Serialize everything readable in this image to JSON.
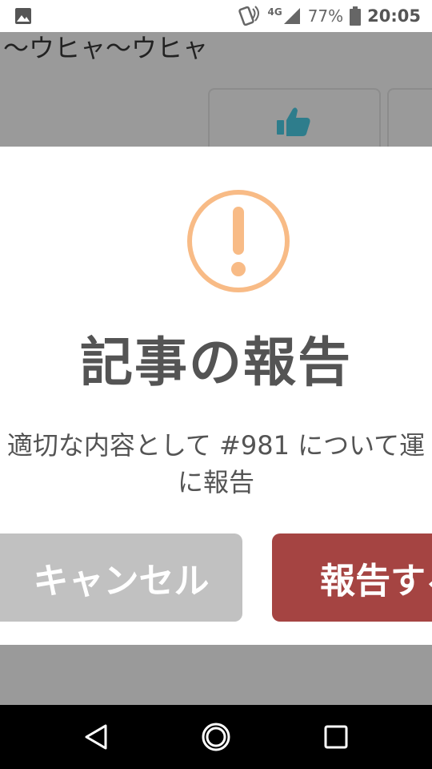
{
  "status_bar": {
    "network": "4G",
    "battery": "77%",
    "time": "20:05",
    "icons": [
      "image-icon",
      "nfc-phone-icon",
      "signal-icon",
      "battery-icon"
    ]
  },
  "background": {
    "text": "〜ウヒャ〜ウヒャ",
    "like_icon": "thumbs-up-icon",
    "accent_color": "#2e7d8c"
  },
  "dialog": {
    "icon": "exclamation-circle-icon",
    "icon_color": "#f8bb86",
    "title": "記事の報告",
    "message_line1": "適切な内容として #981 について運",
    "message_line2": "に報告",
    "cancel_label": "キャンセル",
    "confirm_label": "報告する",
    "cancel_color": "#c1c1c1",
    "confirm_color": "#a54442"
  },
  "nav_bar": {
    "icons": [
      "back-icon",
      "home-icon",
      "recent-apps-icon"
    ]
  }
}
